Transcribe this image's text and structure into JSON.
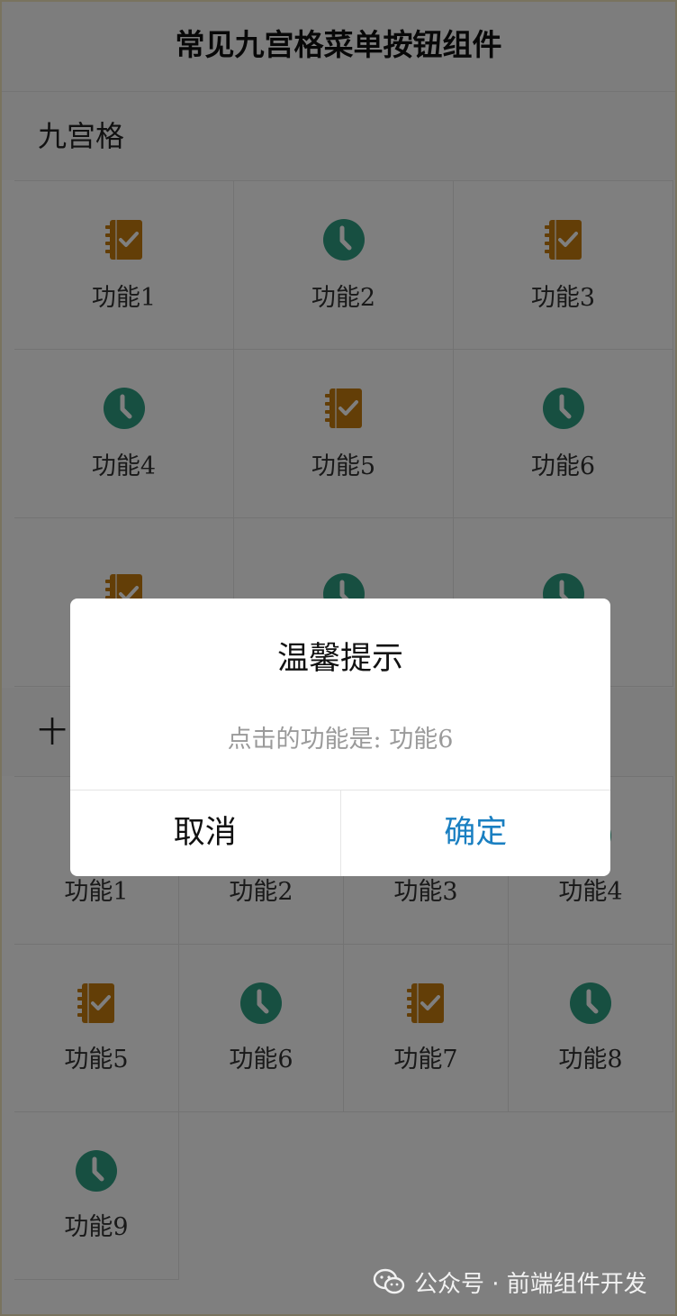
{
  "header": {
    "title": "常见九宫格菜单按钮组件"
  },
  "section1": {
    "title": "九宫格",
    "items": [
      {
        "label": "功能1",
        "icon": "notebook-check-icon"
      },
      {
        "label": "功能2",
        "icon": "clock-icon"
      },
      {
        "label": "功能3",
        "icon": "notebook-check-icon"
      },
      {
        "label": "功能4",
        "icon": "clock-icon"
      },
      {
        "label": "功能5",
        "icon": "notebook-check-icon"
      },
      {
        "label": "功能6",
        "icon": "clock-icon"
      },
      {
        "label": "",
        "icon": "notebook-check-icon"
      },
      {
        "label": "",
        "icon": "clock-icon"
      },
      {
        "label": "",
        "icon": "clock-icon"
      }
    ]
  },
  "section2": {
    "title": "十",
    "items": [
      {
        "label": "功能1",
        "icon": "notebook-check-icon"
      },
      {
        "label": "功能2",
        "icon": "clock-icon"
      },
      {
        "label": "功能3",
        "icon": "notebook-check-icon"
      },
      {
        "label": "功能4",
        "icon": "clock-icon"
      },
      {
        "label": "功能5",
        "icon": "notebook-check-icon"
      },
      {
        "label": "功能6",
        "icon": "clock-icon"
      },
      {
        "label": "功能7",
        "icon": "notebook-check-icon"
      },
      {
        "label": "功能8",
        "icon": "clock-icon"
      },
      {
        "label": "功能9",
        "icon": "clock-icon"
      }
    ]
  },
  "dialog": {
    "title": "温馨提示",
    "message": "点击的功能是: 功能6",
    "cancel_label": "取消",
    "confirm_label": "确定"
  },
  "watermark": {
    "text": "公众号 · 前端组件开发",
    "icon": "wechat-icon"
  },
  "colors": {
    "notebook": "#c67d0e",
    "clock": "#2e9e82",
    "confirm": "#1a7fc1",
    "overlay": "rgba(0,0,0,0.5)"
  }
}
